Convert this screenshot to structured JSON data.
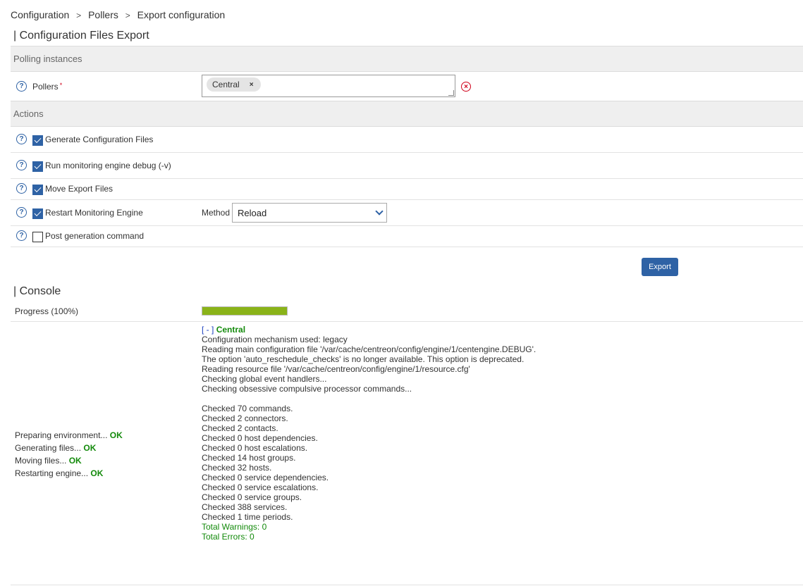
{
  "breadcrumb": [
    "Configuration",
    "Pollers",
    "Export configuration"
  ],
  "breadcrumb_separator": ">",
  "page_title": "| Configuration Files Export",
  "polling_section": {
    "title": "Polling instances"
  },
  "pollers_field": {
    "label": "Pollers",
    "required_mark": "*",
    "selected": [
      "Central"
    ],
    "chip_remove": "×"
  },
  "actions_section": {
    "title": "Actions"
  },
  "actions": [
    {
      "label": "Generate Configuration Files",
      "checked": true
    },
    {
      "label": "Run monitoring engine debug (-v)",
      "checked": true
    },
    {
      "label": "Move Export Files",
      "checked": true
    },
    {
      "label": "Restart Monitoring Engine",
      "checked": true
    },
    {
      "label": "Post generation command",
      "checked": false
    }
  ],
  "method": {
    "label": "Method",
    "value": "Reload"
  },
  "export_button": "Export",
  "console": {
    "title": "| Console",
    "progress_label": "Progress (100%)",
    "progress_percent": 100,
    "steps": [
      {
        "text": "Preparing environment...",
        "status": "OK"
      },
      {
        "text": "Generating files...",
        "status": "OK"
      },
      {
        "text": "Moving files...",
        "status": "OK"
      },
      {
        "text": "Restarting engine...",
        "status": "OK"
      }
    ],
    "log_toggle": "[ - ]",
    "log_server": "Central",
    "log_lines": [
      "Configuration mechanism used: legacy",
      "Reading main configuration file '/var/cache/centreon/config/engine/1/centengine.DEBUG'.",
      "The option 'auto_reschedule_checks' is no longer available. This option is deprecated.",
      "Reading resource file '/var/cache/centreon/config/engine/1/resource.cfg'",
      "Checking global event handlers...",
      "Checking obsessive compulsive processor commands...",
      "",
      "Checked 70 commands.",
      "Checked 2 connectors.",
      "Checked 2 contacts.",
      "Checked 0 host dependencies.",
      "Checked 0 host escalations.",
      "Checked 14 host groups.",
      "Checked 32 hosts.",
      "Checked 0 service dependencies.",
      "Checked 0 service escalations.",
      "Checked 0 service groups.",
      "Checked 388 services.",
      "Checked 1 time periods."
    ],
    "log_summary": [
      "Total Warnings: 0",
      "Total Errors: 0"
    ]
  },
  "colors": {
    "accent": "#2e62a5",
    "ok": "#138a0b",
    "progress": "#8ab319",
    "error": "#d0021b"
  }
}
